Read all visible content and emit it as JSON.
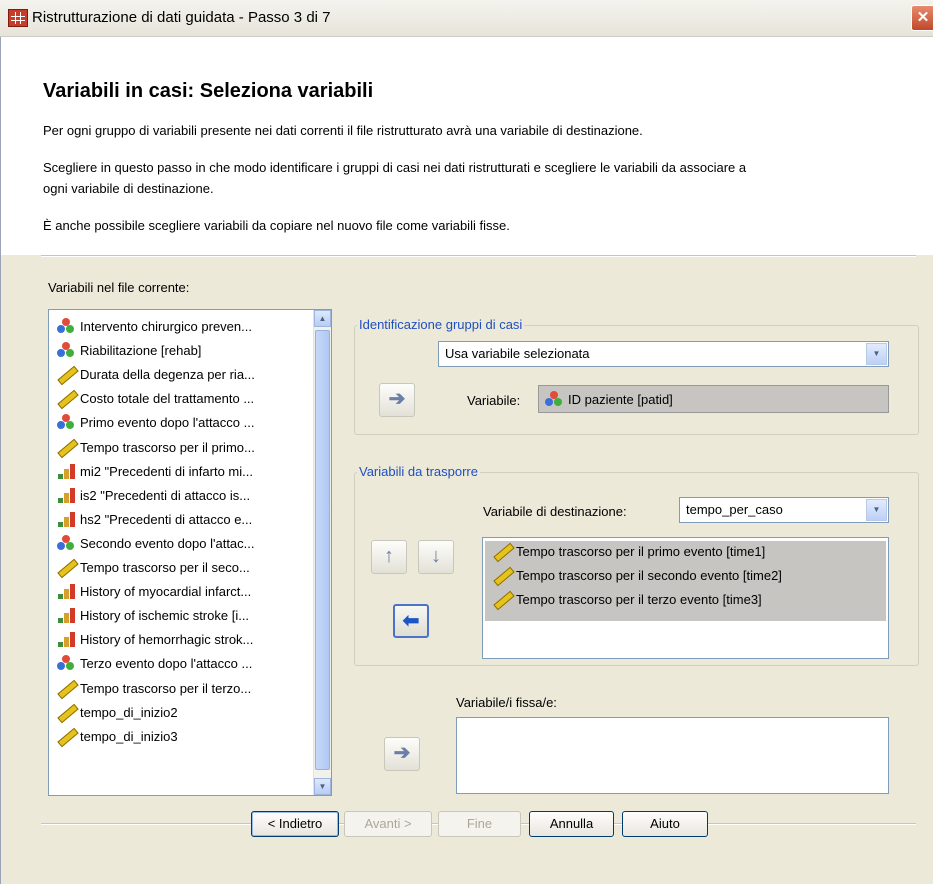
{
  "window": {
    "title": "Ristrutturazione di dati guidata - Passo 3 di 7",
    "close_glyph": "✕"
  },
  "header": {
    "heading": "Variabili in casi: Seleziona variabili",
    "para1": "Per ogni gruppo di variabili presente nei dati correnti il file ristrutturato avrà una variabile di destinazione.",
    "para2_line1": "Scegliere in questo passo in che modo identificare i gruppi di casi nei dati ristrutturati e scegliere le variabili da associare a",
    "para2_line2": "ogni variabile di destinazione.",
    "para3": "È anche possibile scegliere variabili da copiare nel nuovo file come variabili fisse."
  },
  "source_list": {
    "label": "Variabili nel file corrente:",
    "items": [
      {
        "label": "Intervento chirurgico preven...",
        "icon": "nominal"
      },
      {
        "label": "Riabilitazione [rehab]",
        "icon": "nominal"
      },
      {
        "label": "Durata della degenza per ria...",
        "icon": "scale"
      },
      {
        "label": "Costo totale del trattamento ...",
        "icon": "scale"
      },
      {
        "label": "Primo evento dopo l'attacco ...",
        "icon": "nominal"
      },
      {
        "label": "Tempo trascorso per il primo...",
        "icon": "scale"
      },
      {
        "label": "mi2 \"Precedenti di infarto mi...",
        "icon": "ordinal"
      },
      {
        "label": "is2 \"Precedenti di attacco is...",
        "icon": "ordinal"
      },
      {
        "label": "hs2 \"Precedenti di attacco e...",
        "icon": "ordinal"
      },
      {
        "label": "Secondo evento dopo l'attac...",
        "icon": "nominal"
      },
      {
        "label": "Tempo trascorso per il seco...",
        "icon": "scale"
      },
      {
        "label": "History of myocardial infarct...",
        "icon": "ordinal"
      },
      {
        "label": "History of ischemic stroke [i...",
        "icon": "ordinal"
      },
      {
        "label": "History of hemorrhagic strok...",
        "icon": "ordinal"
      },
      {
        "label": "Terzo evento dopo l'attacco ...",
        "icon": "nominal"
      },
      {
        "label": "Tempo trascorso per il terzo...",
        "icon": "scale"
      },
      {
        "label": "tempo_di_inizio2",
        "icon": "scale"
      },
      {
        "label": "tempo_di_inizio3",
        "icon": "scale"
      }
    ]
  },
  "case_group": {
    "title": "Identificazione gruppi di casi",
    "method": "Usa variabile selezionata",
    "variable_label": "Variabile:",
    "variable_value": "ID paziente [patid]"
  },
  "transpose": {
    "title": "Variabili da trasporre",
    "target_label": "Variabile di destinazione:",
    "target_value": "tempo_per_caso",
    "items": [
      "Tempo trascorso per il primo evento [time1]",
      "Tempo trascorso per il secondo evento [time2]",
      "Tempo trascorso per il terzo evento [time3]"
    ]
  },
  "fixed": {
    "label": "Variabile/i fissa/e:"
  },
  "glyphs": {
    "move_right": "➔",
    "move_left": "⬅",
    "move_up": "↑",
    "move_down": "↓",
    "scroll_up": "▲",
    "scroll_down": "▼",
    "dropdown": "▼"
  },
  "buttons": {
    "back": "< Indietro",
    "next": "Avanti >",
    "finish": "Fine",
    "cancel": "Annulla",
    "help": "Aiuto"
  }
}
